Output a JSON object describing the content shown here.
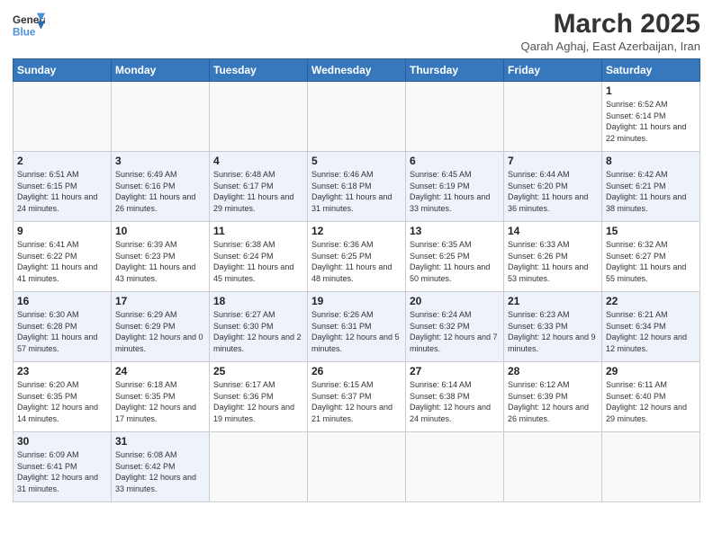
{
  "logo": {
    "line1": "General",
    "line2": "Blue"
  },
  "title": "March 2025",
  "subtitle": "Qarah Aghaj, East Azerbaijan, Iran",
  "weekdays": [
    "Sunday",
    "Monday",
    "Tuesday",
    "Wednesday",
    "Thursday",
    "Friday",
    "Saturday"
  ],
  "weeks": [
    [
      {
        "day": "",
        "info": ""
      },
      {
        "day": "",
        "info": ""
      },
      {
        "day": "",
        "info": ""
      },
      {
        "day": "",
        "info": ""
      },
      {
        "day": "",
        "info": ""
      },
      {
        "day": "",
        "info": ""
      },
      {
        "day": "1",
        "info": "Sunrise: 6:52 AM\nSunset: 6:14 PM\nDaylight: 11 hours\nand 22 minutes."
      }
    ],
    [
      {
        "day": "2",
        "info": "Sunrise: 6:51 AM\nSunset: 6:15 PM\nDaylight: 11 hours\nand 24 minutes."
      },
      {
        "day": "3",
        "info": "Sunrise: 6:49 AM\nSunset: 6:16 PM\nDaylight: 11 hours\nand 26 minutes."
      },
      {
        "day": "4",
        "info": "Sunrise: 6:48 AM\nSunset: 6:17 PM\nDaylight: 11 hours\nand 29 minutes."
      },
      {
        "day": "5",
        "info": "Sunrise: 6:46 AM\nSunset: 6:18 PM\nDaylight: 11 hours\nand 31 minutes."
      },
      {
        "day": "6",
        "info": "Sunrise: 6:45 AM\nSunset: 6:19 PM\nDaylight: 11 hours\nand 33 minutes."
      },
      {
        "day": "7",
        "info": "Sunrise: 6:44 AM\nSunset: 6:20 PM\nDaylight: 11 hours\nand 36 minutes."
      },
      {
        "day": "8",
        "info": "Sunrise: 6:42 AM\nSunset: 6:21 PM\nDaylight: 11 hours\nand 38 minutes."
      }
    ],
    [
      {
        "day": "9",
        "info": "Sunrise: 6:41 AM\nSunset: 6:22 PM\nDaylight: 11 hours\nand 41 minutes."
      },
      {
        "day": "10",
        "info": "Sunrise: 6:39 AM\nSunset: 6:23 PM\nDaylight: 11 hours\nand 43 minutes."
      },
      {
        "day": "11",
        "info": "Sunrise: 6:38 AM\nSunset: 6:24 PM\nDaylight: 11 hours\nand 45 minutes."
      },
      {
        "day": "12",
        "info": "Sunrise: 6:36 AM\nSunset: 6:25 PM\nDaylight: 11 hours\nand 48 minutes."
      },
      {
        "day": "13",
        "info": "Sunrise: 6:35 AM\nSunset: 6:25 PM\nDaylight: 11 hours\nand 50 minutes."
      },
      {
        "day": "14",
        "info": "Sunrise: 6:33 AM\nSunset: 6:26 PM\nDaylight: 11 hours\nand 53 minutes."
      },
      {
        "day": "15",
        "info": "Sunrise: 6:32 AM\nSunset: 6:27 PM\nDaylight: 11 hours\nand 55 minutes."
      }
    ],
    [
      {
        "day": "16",
        "info": "Sunrise: 6:30 AM\nSunset: 6:28 PM\nDaylight: 11 hours\nand 57 minutes."
      },
      {
        "day": "17",
        "info": "Sunrise: 6:29 AM\nSunset: 6:29 PM\nDaylight: 12 hours\nand 0 minutes."
      },
      {
        "day": "18",
        "info": "Sunrise: 6:27 AM\nSunset: 6:30 PM\nDaylight: 12 hours\nand 2 minutes."
      },
      {
        "day": "19",
        "info": "Sunrise: 6:26 AM\nSunset: 6:31 PM\nDaylight: 12 hours\nand 5 minutes."
      },
      {
        "day": "20",
        "info": "Sunrise: 6:24 AM\nSunset: 6:32 PM\nDaylight: 12 hours\nand 7 minutes."
      },
      {
        "day": "21",
        "info": "Sunrise: 6:23 AM\nSunset: 6:33 PM\nDaylight: 12 hours\nand 9 minutes."
      },
      {
        "day": "22",
        "info": "Sunrise: 6:21 AM\nSunset: 6:34 PM\nDaylight: 12 hours\nand 12 minutes."
      }
    ],
    [
      {
        "day": "23",
        "info": "Sunrise: 6:20 AM\nSunset: 6:35 PM\nDaylight: 12 hours\nand 14 minutes."
      },
      {
        "day": "24",
        "info": "Sunrise: 6:18 AM\nSunset: 6:35 PM\nDaylight: 12 hours\nand 17 minutes."
      },
      {
        "day": "25",
        "info": "Sunrise: 6:17 AM\nSunset: 6:36 PM\nDaylight: 12 hours\nand 19 minutes."
      },
      {
        "day": "26",
        "info": "Sunrise: 6:15 AM\nSunset: 6:37 PM\nDaylight: 12 hours\nand 21 minutes."
      },
      {
        "day": "27",
        "info": "Sunrise: 6:14 AM\nSunset: 6:38 PM\nDaylight: 12 hours\nand 24 minutes."
      },
      {
        "day": "28",
        "info": "Sunrise: 6:12 AM\nSunset: 6:39 PM\nDaylight: 12 hours\nand 26 minutes."
      },
      {
        "day": "29",
        "info": "Sunrise: 6:11 AM\nSunset: 6:40 PM\nDaylight: 12 hours\nand 29 minutes."
      }
    ],
    [
      {
        "day": "30",
        "info": "Sunrise: 6:09 AM\nSunset: 6:41 PM\nDaylight: 12 hours\nand 31 minutes."
      },
      {
        "day": "31",
        "info": "Sunrise: 6:08 AM\nSunset: 6:42 PM\nDaylight: 12 hours\nand 33 minutes."
      },
      {
        "day": "",
        "info": ""
      },
      {
        "day": "",
        "info": ""
      },
      {
        "day": "",
        "info": ""
      },
      {
        "day": "",
        "info": ""
      },
      {
        "day": "",
        "info": ""
      }
    ]
  ]
}
